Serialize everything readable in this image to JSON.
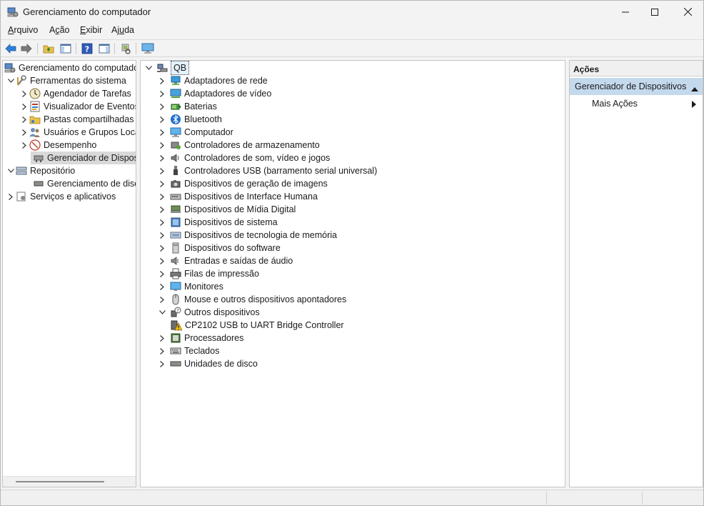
{
  "window": {
    "title": "Gerenciamento do computador"
  },
  "menu": [
    {
      "key": "A",
      "rest": "rquivo"
    },
    {
      "pre": "A",
      "key": "ç",
      "rest": "ão"
    },
    {
      "key": "E",
      "rest": "xibir"
    },
    {
      "pre": "Aj",
      "key": "u",
      "rest": "da"
    }
  ],
  "left_tree": {
    "root": "Gerenciamento do computador (Local)",
    "items": [
      {
        "label": "Ferramentas do sistema"
      },
      {
        "label": "Agendador de Tarefas"
      },
      {
        "label": "Visualizador de Eventos"
      },
      {
        "label": "Pastas compartilhadas"
      },
      {
        "label": "Usuários e Grupos Locais"
      },
      {
        "label": "Desempenho"
      },
      {
        "label": "Gerenciador de Dispositivos"
      },
      {
        "label": "Repositório"
      },
      {
        "label": "Gerenciamento de disco"
      },
      {
        "label": "Serviços e aplicativos"
      }
    ]
  },
  "device_tree": {
    "root": "QB",
    "categories": [
      {
        "label": "Adaptadores de rede",
        "icon": "network-adapter-icon"
      },
      {
        "label": "Adaptadores de vídeo",
        "icon": "display-adapter-icon"
      },
      {
        "label": "Baterias",
        "icon": "battery-icon"
      },
      {
        "label": "Bluetooth",
        "icon": "bluetooth-icon"
      },
      {
        "label": "Computador",
        "icon": "computer-icon"
      },
      {
        "label": "Controladores de armazenamento",
        "icon": "storage-controller-icon"
      },
      {
        "label": "Controladores de som, vídeo e jogos",
        "icon": "speaker-icon"
      },
      {
        "label": "Controladores USB (barramento serial universal)",
        "icon": "usb-icon"
      },
      {
        "label": "Dispositivos de geração de imagens",
        "icon": "camera-icon"
      },
      {
        "label": "Dispositivos de Interface Humana",
        "icon": "hid-icon"
      },
      {
        "label": "Dispositivos de Mídia Digital",
        "icon": "media-device-icon"
      },
      {
        "label": "Dispositivos de sistema",
        "icon": "system-device-icon"
      },
      {
        "label": "Dispositivos de tecnologia de memória",
        "icon": "memory-icon"
      },
      {
        "label": "Dispositivos do software",
        "icon": "software-device-icon"
      },
      {
        "label": "Entradas e saídas de áudio",
        "icon": "audio-io-icon"
      },
      {
        "label": "Filas de impressão",
        "icon": "printer-icon"
      },
      {
        "label": "Monitores",
        "icon": "monitor-icon"
      },
      {
        "label": "Mouse e outros dispositivos apontadores",
        "icon": "mouse-icon"
      },
      {
        "label": "Outros dispositivos",
        "icon": "unknown-device-icon",
        "expanded": true
      },
      {
        "label": "CP2102 USB to UART Bridge Controller",
        "icon": "warning-device-icon",
        "child": true
      },
      {
        "label": "Processadores",
        "icon": "processor-icon"
      },
      {
        "label": "Teclados",
        "icon": "keyboard-icon"
      },
      {
        "label": "Unidades de disco",
        "icon": "disk-drive-icon"
      }
    ]
  },
  "actions": {
    "title": "Ações",
    "section": "Gerenciador de Dispositivos",
    "more": "Mais Ações"
  }
}
